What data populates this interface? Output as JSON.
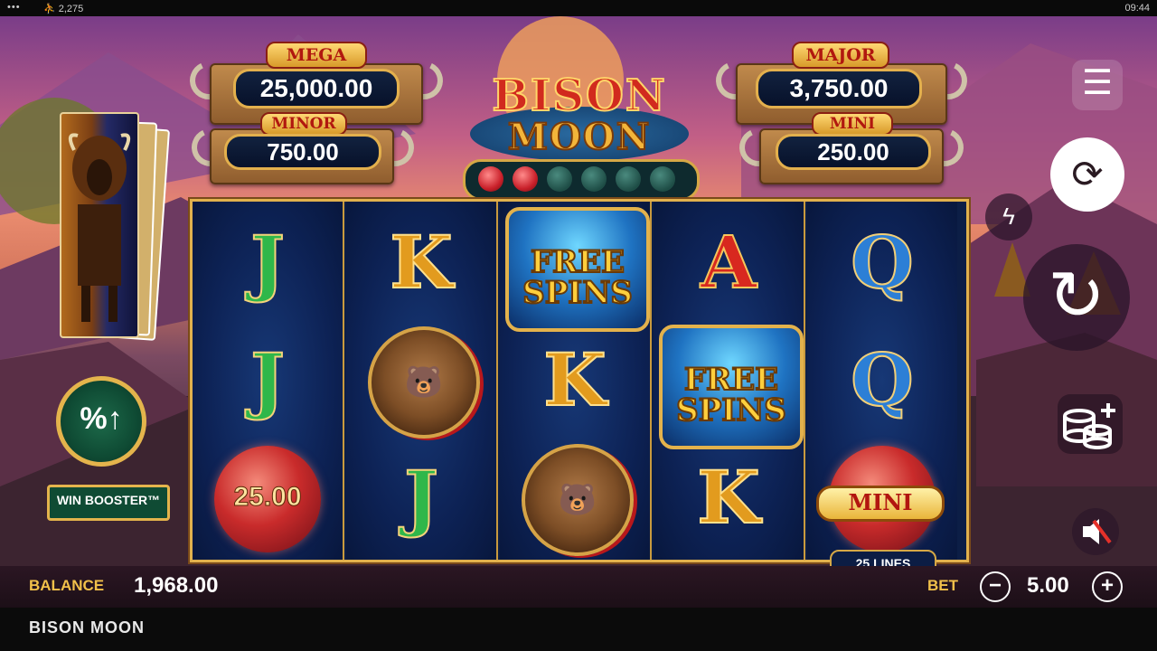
{
  "system_bar": {
    "dots": "•••",
    "users": "⛹ 2,275",
    "time": "09:44"
  },
  "game": {
    "title_line1": "BISON",
    "title_line2": "MOON",
    "footer_name": "BISON MOON"
  },
  "jackpots": {
    "mega": {
      "label": "MEGA",
      "value": "25,000.00"
    },
    "major": {
      "label": "MAJOR",
      "value": "3,750.00"
    },
    "minor": {
      "label": "MINOR",
      "value": "750.00"
    },
    "mini": {
      "label": "MINI",
      "value": "250.00"
    }
  },
  "moon_meter": {
    "filled": 2,
    "total": 6
  },
  "reels": [
    [
      "J",
      "J",
      "moon:25.00"
    ],
    [
      "K",
      "bear",
      "J"
    ],
    [
      "free_spins",
      "K",
      "bear"
    ],
    [
      "A",
      "free_spins",
      "K"
    ],
    [
      "Q",
      "Q",
      "moon:MINI"
    ]
  ],
  "symbols": {
    "free_spins_line1": "FREE",
    "free_spins_line2": "SPINS",
    "moon_value": "25.00",
    "mini_tag": "MINI"
  },
  "lines_badge": "25 LINES",
  "win_booster_label": "WIN BOOSTER™",
  "bottom": {
    "balance_label": "BALANCE",
    "balance_value": "1,968.00",
    "bet_label": "BET",
    "bet_value": "5.00",
    "minus": "−",
    "plus": "+"
  },
  "colors": {
    "accent_gold": "#e3b04d",
    "reel_blue": "#0d2255",
    "moon_red": "#c92b2b"
  }
}
